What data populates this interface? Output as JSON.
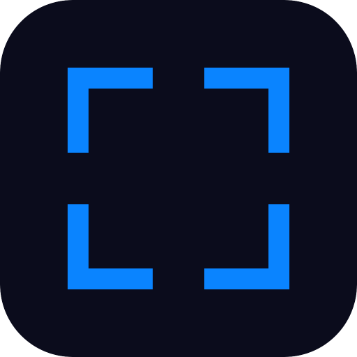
{
  "icon": {
    "name": "fullscreen-frame-icon",
    "background_color": "#0b0c1c",
    "accent_color": "#0a84ff"
  }
}
